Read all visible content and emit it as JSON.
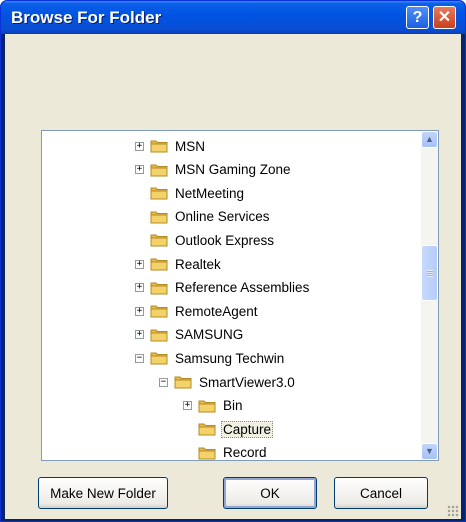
{
  "window": {
    "title": "Browse For Folder",
    "help_label": "?",
    "close_label": "✕"
  },
  "tree": {
    "items": [
      {
        "label": "MSN",
        "expander": "+",
        "level": 0
      },
      {
        "label": "MSN Gaming Zone",
        "expander": "+",
        "level": 0
      },
      {
        "label": "NetMeeting",
        "expander": "",
        "level": 0
      },
      {
        "label": "Online Services",
        "expander": "",
        "level": 0
      },
      {
        "label": "Outlook Express",
        "expander": "",
        "level": 0
      },
      {
        "label": "Realtek",
        "expander": "+",
        "level": 0
      },
      {
        "label": "Reference Assemblies",
        "expander": "+",
        "level": 0
      },
      {
        "label": "RemoteAgent",
        "expander": "+",
        "level": 0
      },
      {
        "label": "SAMSUNG",
        "expander": "+",
        "level": 0
      },
      {
        "label": "Samsung Techwin",
        "expander": "−",
        "level": 0
      },
      {
        "label": "SmartViewer3.0",
        "expander": "−",
        "level": 1
      },
      {
        "label": "Bin",
        "expander": "+",
        "level": 2
      },
      {
        "label": "Capture",
        "expander": "",
        "level": 2,
        "selected": true
      },
      {
        "label": "Record",
        "expander": "",
        "level": 2
      }
    ]
  },
  "scrollbar": {
    "up": "▲",
    "down": "▼"
  },
  "buttons": {
    "make_new_folder": "Make New Folder",
    "ok": "OK",
    "cancel": "Cancel"
  },
  "colors": {
    "titlebar": "#0054e3",
    "folder": "#f4d26a",
    "selection": "#f1efe2"
  }
}
